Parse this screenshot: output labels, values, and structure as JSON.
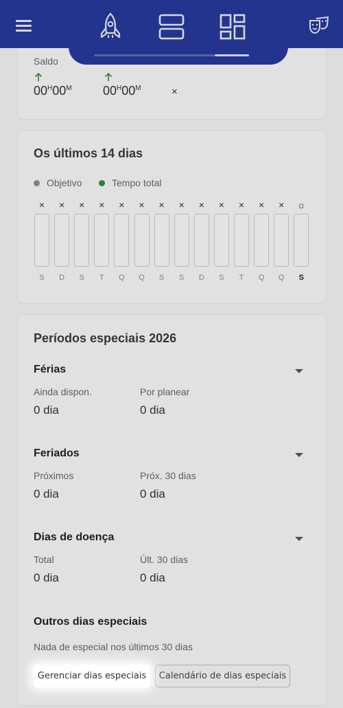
{
  "header": {
    "menu_icon": "hamburger-menu-icon",
    "tabs": [
      {
        "icon": "rocket-icon"
      },
      {
        "icon": "rows-layout-icon"
      },
      {
        "icon": "dashboard-grid-icon",
        "active": true
      }
    ],
    "right_icon": "theater-masks-icon"
  },
  "saldo": {
    "label": "Saldo",
    "value_a": {
      "h": "00",
      "h_unit": "H",
      "m": "00",
      "m_unit": "M"
    },
    "value_b": {
      "h": "00",
      "h_unit": "H",
      "m": "00",
      "m_unit": "M"
    },
    "dismiss": "×"
  },
  "last14": {
    "title": "Os últimos 14 dias",
    "legend": [
      {
        "label": "Objetivo",
        "color": "#8a8a8a"
      },
      {
        "label": "Tempo total",
        "color": "#2e8b3a"
      }
    ],
    "marks": [
      "×",
      "×",
      "×",
      "×",
      "×",
      "×",
      "×",
      "×",
      "×",
      "×",
      "×",
      "×",
      "×",
      "☼"
    ],
    "days": [
      "S",
      "D",
      "S",
      "T",
      "Q",
      "Q",
      "S",
      "S",
      "D",
      "S",
      "T",
      "Q",
      "Q",
      "S"
    ]
  },
  "special": {
    "title": "Períodos especiais 2026",
    "ferias": {
      "title": "Férias",
      "l1": "Ainda dispon.",
      "v1": "0 dia",
      "l2": "Por planear",
      "v2": "0 dia"
    },
    "feriados": {
      "title": "Feriados",
      "l1": "Próximos",
      "v1": "0 dia",
      "l2": "Próx. 30 dias",
      "v2": "0 dia"
    },
    "doenca": {
      "title": "Dias de doença",
      "l1": "Total",
      "v1": "0 dia",
      "l2": "Últ. 30 dias",
      "v2": "0 dia"
    },
    "outros": {
      "title": "Outros dias especiais",
      "note": "Nada de especial nos últimos 30 dias"
    },
    "btn_manage": "Gerenciar dias especiais",
    "btn_calendar": "Calendário de dias especiais"
  }
}
